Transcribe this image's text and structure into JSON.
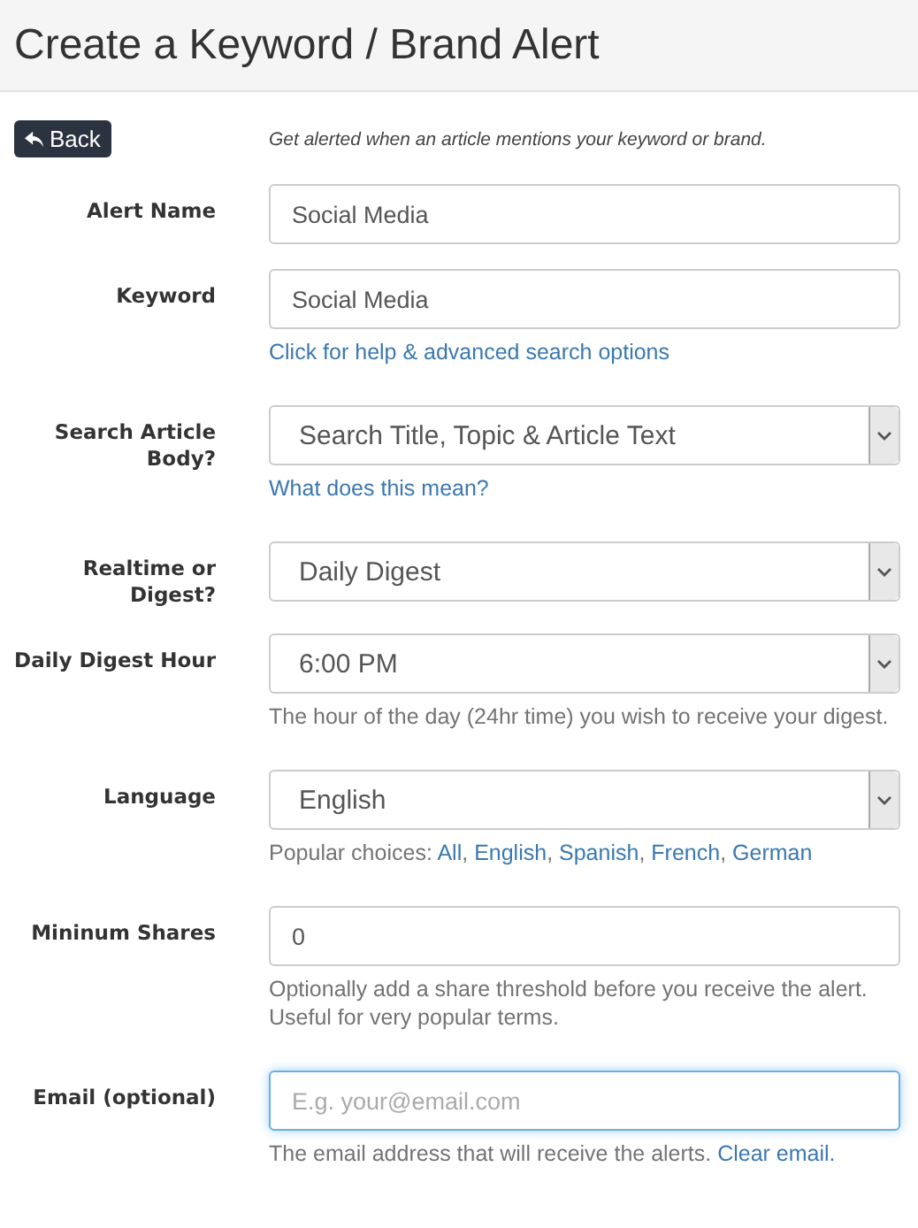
{
  "page": {
    "title": "Create a Keyword / Brand Alert"
  },
  "back_button": {
    "label": "Back"
  },
  "intro": "Get alerted when an article mentions your keyword or brand.",
  "fields": [
    {
      "label": "Alert Name",
      "kind": "text",
      "value": "Social Media",
      "focused": false
    },
    {
      "label": "Keyword",
      "kind": "text",
      "value": "Social Media",
      "focused": false,
      "help": [
        {
          "text": "Click for help & advanced search options",
          "link": true
        }
      ]
    },
    {
      "label": "Search Article Body?",
      "kind": "select",
      "value": "Search Title, Topic & Article Text",
      "focused": false,
      "help": [
        {
          "text": "What does this mean?",
          "link": true
        }
      ]
    },
    {
      "label": "Realtime or Digest?",
      "kind": "select",
      "value": "Daily Digest",
      "focused": false
    },
    {
      "label": "Daily Digest Hour",
      "kind": "select",
      "value": "6:00 PM",
      "focused": false,
      "help": [
        {
          "text": "The hour of the day (24hr time) you wish to receive your digest.",
          "link": false
        }
      ]
    },
    {
      "label": "Language",
      "kind": "select",
      "value": "English",
      "focused": false,
      "help": [
        {
          "text": "Popular choices: ",
          "link": false
        },
        {
          "text": "All",
          "link": true
        },
        {
          "text": ", ",
          "link": false
        },
        {
          "text": "English",
          "link": true
        },
        {
          "text": ", ",
          "link": false
        },
        {
          "text": "Spanish",
          "link": true
        },
        {
          "text": ", ",
          "link": false
        },
        {
          "text": "French",
          "link": true
        },
        {
          "text": ", ",
          "link": false
        },
        {
          "text": "German",
          "link": true
        }
      ]
    },
    {
      "label": "Mininum Shares",
      "kind": "text",
      "value": "0",
      "focused": false,
      "help": [
        {
          "text": "Optionally add a share threshold before you receive the alert. Useful for very popular terms.",
          "link": false
        }
      ]
    },
    {
      "label": "Email (optional)",
      "kind": "text",
      "placeholder": "E.g. your@email.com",
      "focused": true,
      "help": [
        {
          "text": "The email address that will receive the alerts. ",
          "link": false
        },
        {
          "text": "Clear email.",
          "link": true
        }
      ]
    }
  ]
}
